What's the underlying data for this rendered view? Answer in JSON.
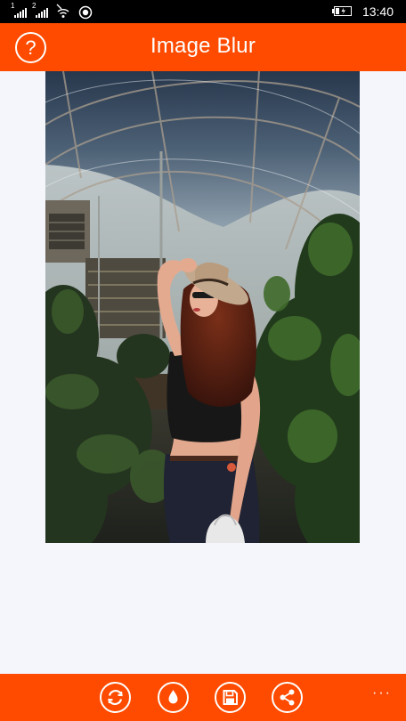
{
  "status_bar": {
    "sim1_label": "1",
    "sim2_label": "2",
    "time": "13:40",
    "icons": [
      "signal-sim1-icon",
      "signal-sim2-icon",
      "wifi-icon",
      "nfc-icon",
      "battery-charging-icon"
    ]
  },
  "header": {
    "help_icon": "help-icon",
    "help_glyph": "?",
    "title": "Image Blur"
  },
  "photo": {
    "subject": "woman-in-greenhouse-photo"
  },
  "app_bar": {
    "buttons": [
      {
        "name": "refresh-icon"
      },
      {
        "name": "blur-drop-icon"
      },
      {
        "name": "save-icon"
      },
      {
        "name": "share-icon"
      }
    ],
    "more_glyph": "···"
  },
  "colors": {
    "accent": "#ff4b00",
    "background": "#f5f6fc",
    "status_bar": "#000000"
  }
}
